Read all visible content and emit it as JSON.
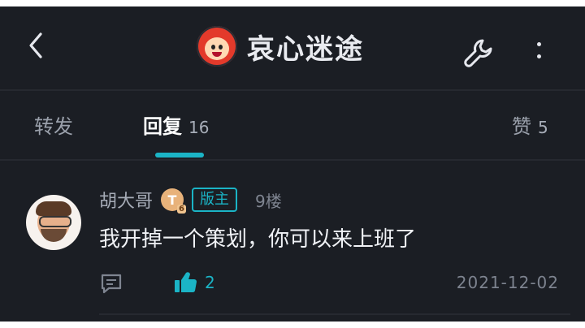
{
  "header": {
    "title": "哀心迷途",
    "icons": {
      "back": "back-arrow-icon",
      "wrench": "wrench-icon",
      "more": "more-vertical-icon",
      "logo": "mascot-avatar-icon"
    }
  },
  "tabs": [
    {
      "label": "转发",
      "count": ""
    },
    {
      "label": "回复",
      "count": "16"
    },
    {
      "label": "赞",
      "count": "5"
    }
  ],
  "accent_color": "#1bb4c6",
  "reply": {
    "username": "胡大哥",
    "level": "T",
    "level_number": "6",
    "role": "版主",
    "floor": "9楼",
    "content": "我开掉一个策划，你可以来上班了",
    "likes": "2",
    "date": "2021-12-02"
  }
}
